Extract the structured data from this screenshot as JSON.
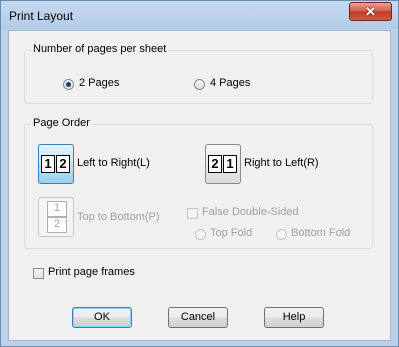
{
  "window": {
    "title": "Print Layout",
    "close_glyph": "✕"
  },
  "pages_per_sheet": {
    "legend": "Number of pages per sheet",
    "options": [
      {
        "label": "2 Pages",
        "checked": true
      },
      {
        "label": "4 Pages",
        "checked": false
      }
    ]
  },
  "page_order": {
    "legend": "Page Order",
    "left_to_right": {
      "label": "Left to Right(L)",
      "page_numbers": [
        "1",
        "2"
      ],
      "selected": true
    },
    "right_to_left": {
      "label": "Right to Left(R)",
      "page_numbers": [
        "2",
        "1"
      ],
      "selected": false
    },
    "top_to_bottom": {
      "label": "Top to Bottom(P)",
      "page_numbers": [
        "1",
        "2"
      ],
      "enabled": false
    },
    "false_double_sided": {
      "label": "False Double-Sided",
      "checked": false,
      "enabled": false
    },
    "top_fold": {
      "label": "Top Fold",
      "enabled": false
    },
    "bottom_fold": {
      "label": "Bottom Fold",
      "enabled": false
    }
  },
  "print_page_frames": {
    "label": "Print page frames",
    "checked": false
  },
  "buttons": {
    "ok": "OK",
    "cancel": "Cancel",
    "help": "Help"
  },
  "colors": {
    "frame": "#bcd2ea",
    "dialog_bg": "#f0f0f0",
    "close_button": "#c94a33",
    "selected_button": "#98d1ef"
  }
}
